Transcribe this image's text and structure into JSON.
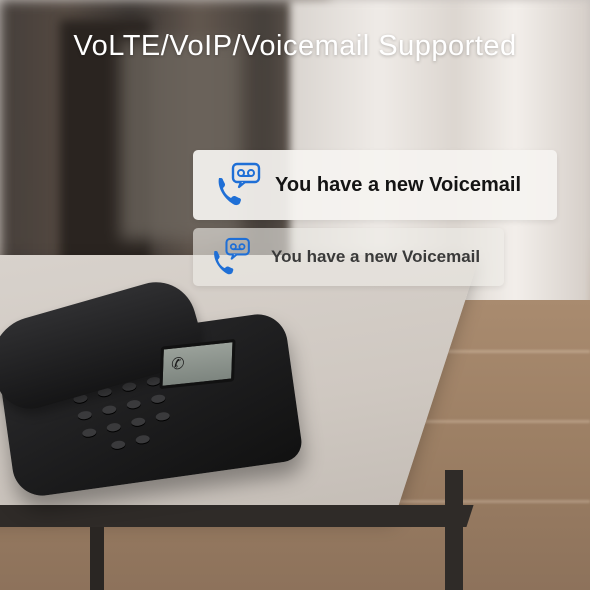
{
  "headline": "VoLTE/VoIP/Voicemail Supported",
  "notifications": [
    {
      "text": "You have a new Voicemail",
      "icon": "phone-voicemail-icon"
    },
    {
      "text": "You have a new Voicemail",
      "icon": "phone-voicemail-icon"
    }
  ],
  "colors": {
    "icon_blue": "#1f6fd6",
    "headline_text": "#ffffff"
  }
}
